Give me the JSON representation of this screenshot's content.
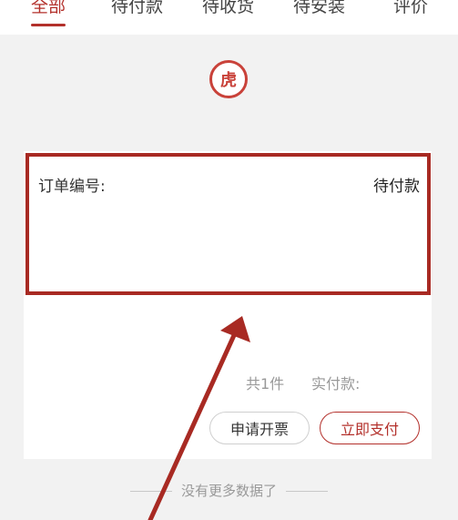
{
  "tabs": [
    {
      "label": "全部",
      "active": true
    },
    {
      "label": "待付款",
      "active": false
    },
    {
      "label": "待收货",
      "active": false
    },
    {
      "label": "待安装",
      "active": false
    },
    {
      "label": "评价",
      "active": false
    }
  ],
  "logo": {
    "text": "虎"
  },
  "order": {
    "number_label": "订单编号:",
    "status": "待付款",
    "count_text": "共1件",
    "paid_label": "实付款:"
  },
  "actions": {
    "invoice_label": "申请开票",
    "pay_label": "立即支付"
  },
  "footer": {
    "no_more_text": "没有更多数据了"
  },
  "colors": {
    "accent": "#b3302b",
    "annotation": "#a82a23",
    "background": "#f2f2f2"
  }
}
